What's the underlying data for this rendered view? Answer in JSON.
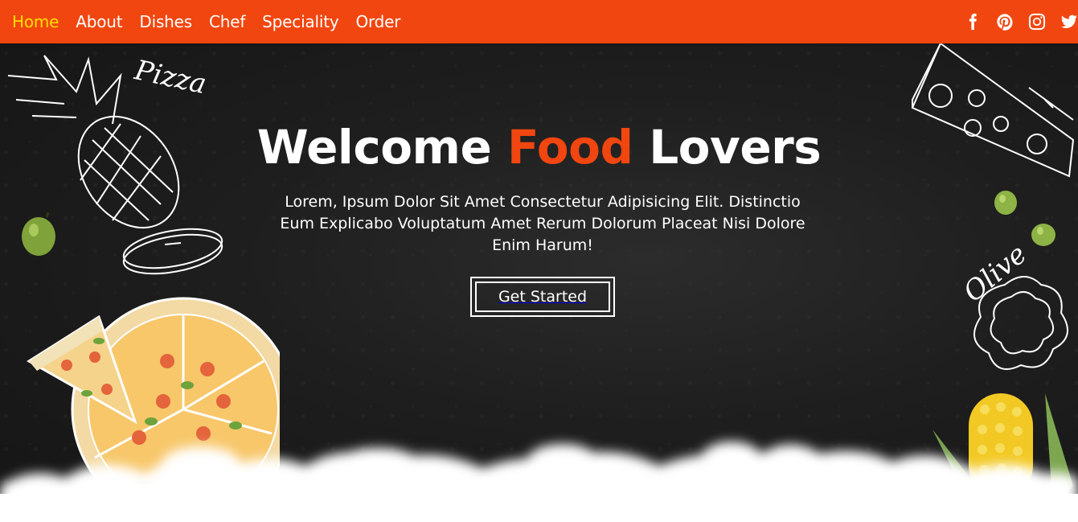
{
  "nav": {
    "items": [
      {
        "label": "Home",
        "active": true
      },
      {
        "label": "About",
        "active": false
      },
      {
        "label": "Dishes",
        "active": false
      },
      {
        "label": "Chef",
        "active": false
      },
      {
        "label": "Speciality",
        "active": false
      },
      {
        "label": "Order",
        "active": false
      }
    ],
    "socials": [
      "facebook-icon",
      "pinterest-icon",
      "instagram-icon",
      "twitter-icon"
    ]
  },
  "hero": {
    "title_part1": "Welcome",
    "title_accent": "Food",
    "title_part2": "Lovers",
    "description": "Lorem, Ipsum Dolor Sit Amet Consectetur Adipisicing Elit. Distinctio Eum Explicabo Voluptatum Amet Rerum Dolorum Placeat Nisi Dolore Enim Harum!",
    "cta_label": "Get Started"
  },
  "doodles": {
    "pizza_label": "Pizza",
    "olive_label": "Olive"
  },
  "colors": {
    "brand": "#f1460f",
    "active_nav": "#ffde00",
    "hero_bg": "#1e1e1e"
  }
}
